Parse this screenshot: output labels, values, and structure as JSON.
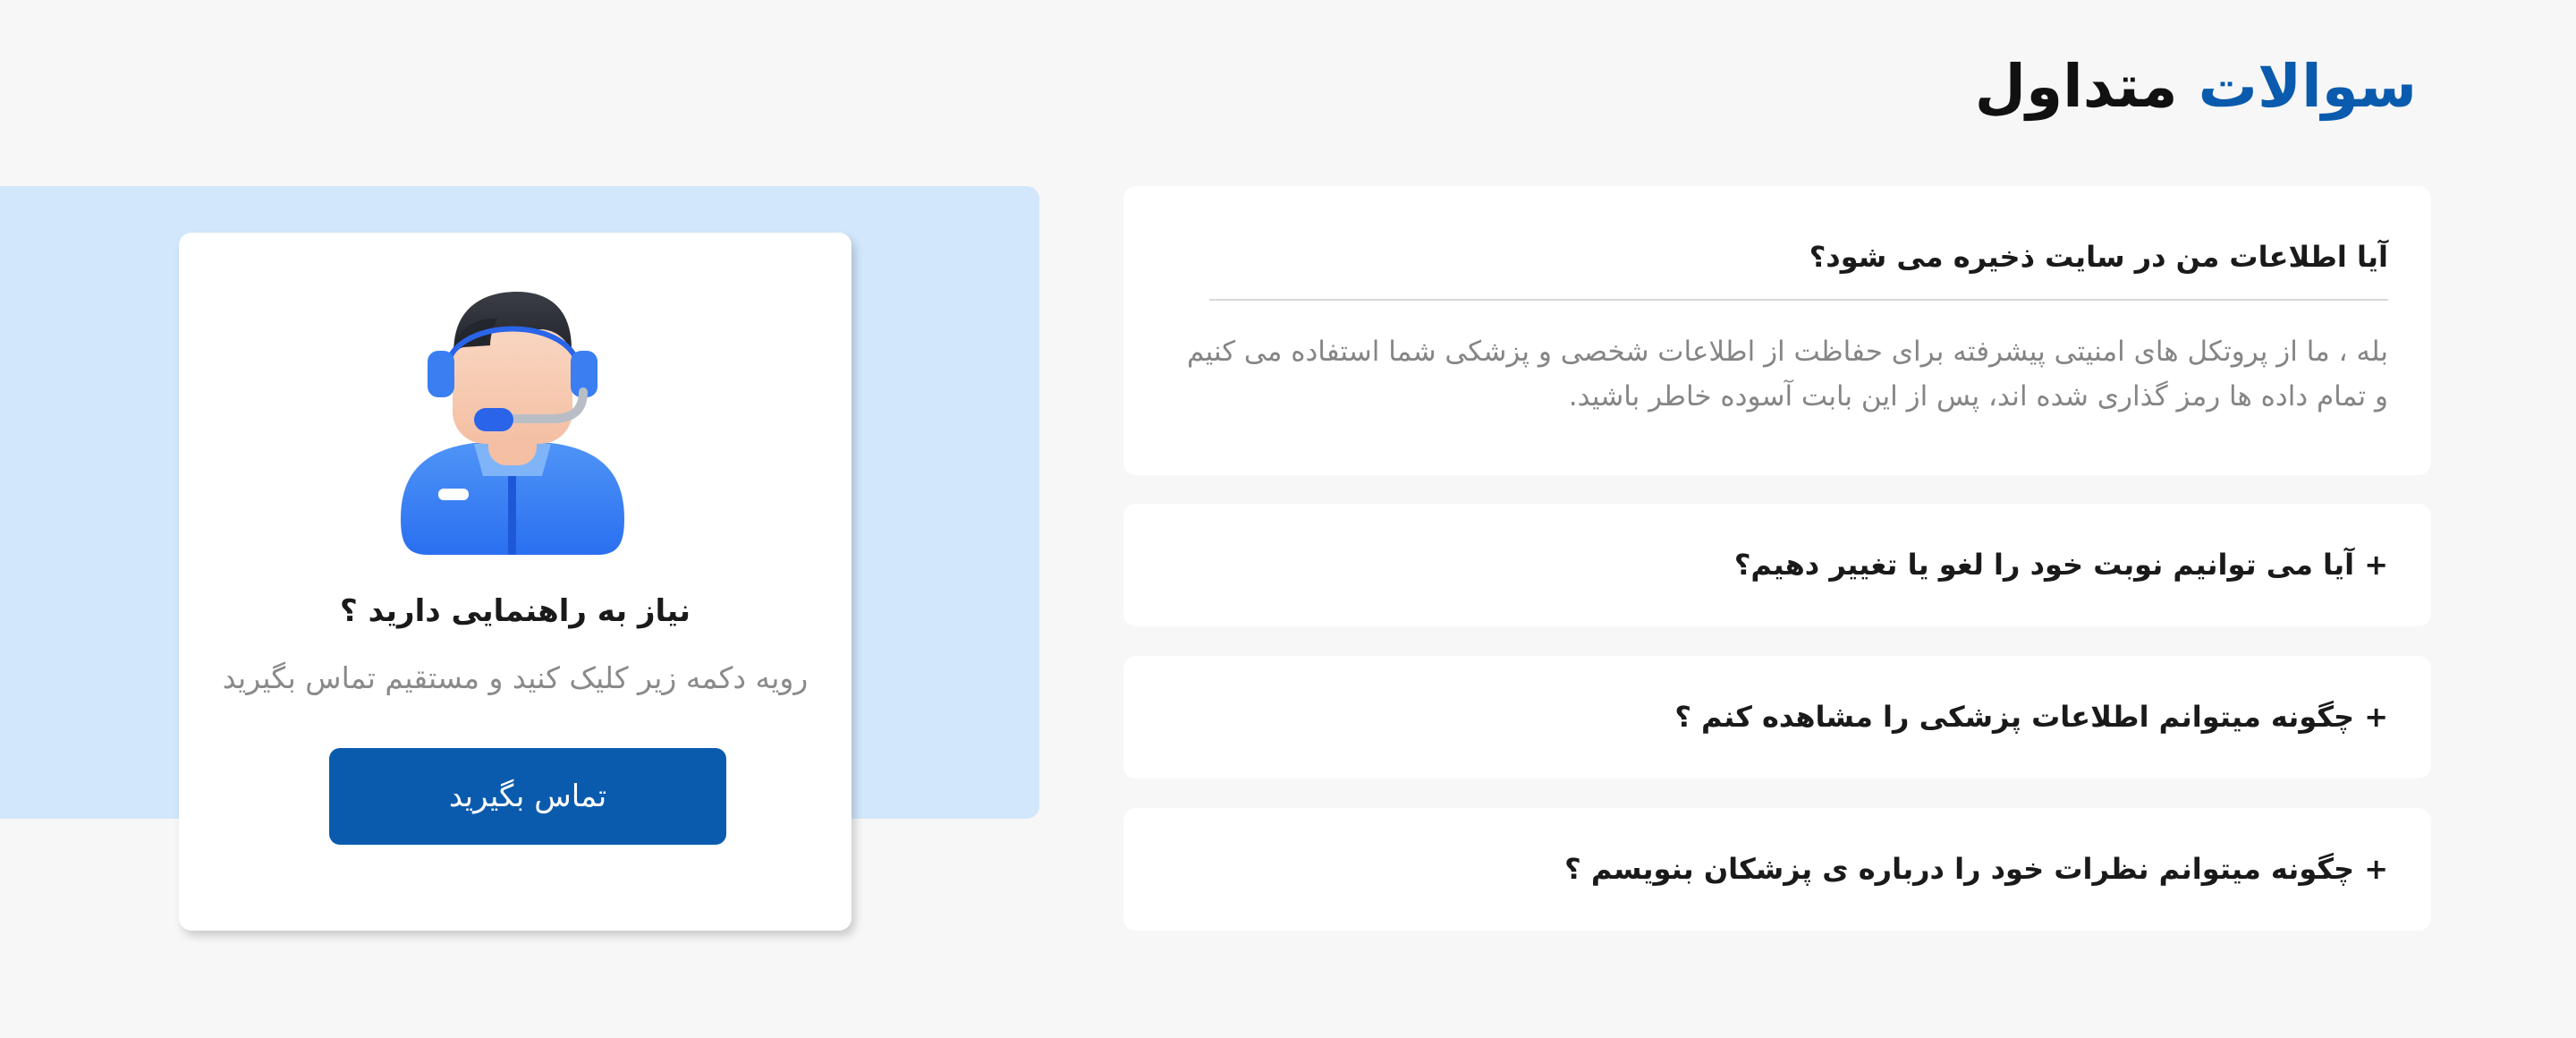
{
  "header": {
    "title_accent": "سوالات",
    "title_rest": "متداول"
  },
  "help": {
    "title": "نیاز به راهنمایی دارید ؟",
    "subtitle": "رویه دکمه زیر کلیک کنید و مستقیم تماس بگیرید",
    "button_label": "تماس بگیرید",
    "avatar_icon": "support-agent-headset-icon"
  },
  "faq": [
    {
      "question": "آیا اطلاعات من در سایت ذخیره می شود؟",
      "expanded": true,
      "answer_lines": [
        "بله ، ما از پروتکل های امنیتی پیشرفته برای حفاظت از اطلاعات شخصی و پزشکی شما استفاده می کنیم",
        "و تمام داده ها رمز گذاری شده اند، پس از این بابت آسوده خاطر باشید."
      ]
    },
    {
      "question": "+ آیا می توانیم نوبت خود را لغو یا تغییر دهیم؟",
      "expanded": false
    },
    {
      "question": "+ چگونه میتوانم اطلاعات پزشکی را مشاهده کنم ؟",
      "expanded": false
    },
    {
      "question": "+ چگونه میتوانم نظرات خود را درباره ی پزشکان بنویسم ؟",
      "expanded": false
    }
  ],
  "colors": {
    "accent": "#0a5bad",
    "panel_blue": "#d2e7fb",
    "background": "#f7f7f7",
    "card": "#ffffff"
  }
}
